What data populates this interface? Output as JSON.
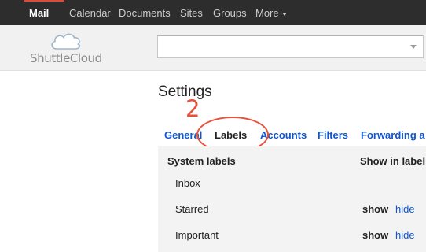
{
  "nav": {
    "mail": "Mail",
    "calendar": "Calendar",
    "documents": "Documents",
    "sites": "Sites",
    "groups": "Groups",
    "more": "More"
  },
  "header": {
    "logo_text": "ShuttleCloud",
    "search_value": ""
  },
  "settings": {
    "title": "Settings",
    "annotation_number": "2",
    "tabs": [
      "General",
      "Labels",
      "Accounts",
      "Filters",
      "Forwarding a"
    ],
    "active_tab": "Labels"
  },
  "labels_table": {
    "section_header": "System labels",
    "show_column_header": "Show in label",
    "rows": [
      {
        "name": "Inbox",
        "show": "",
        "hide": ""
      },
      {
        "name": "Starred",
        "show": "show",
        "hide": "hide"
      },
      {
        "name": "Important",
        "show": "show",
        "hide": "hide"
      }
    ]
  },
  "colors": {
    "topbar_bg": "#2d2d2d",
    "active_accent": "#dd4b39",
    "link": "#1155cc",
    "annotation": "#e8503a"
  },
  "icons": {
    "logo": "cloud-icon",
    "more_caret": "chevron-down-icon",
    "search_caret": "chevron-down-icon"
  }
}
